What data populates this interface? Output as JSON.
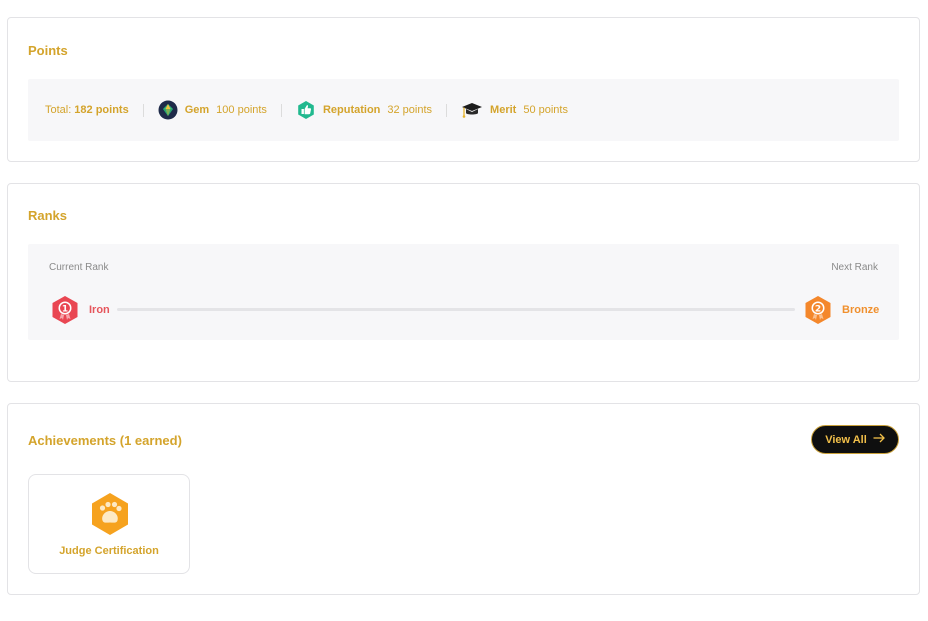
{
  "points": {
    "title": "Points",
    "total_label": "Total:",
    "total_value": "182 points",
    "items": [
      {
        "name": "Gem",
        "value": "100 points",
        "icon": "gem-icon"
      },
      {
        "name": "Reputation",
        "value": "32 points",
        "icon": "thumbs-up-icon"
      },
      {
        "name": "Merit",
        "value": "50 points",
        "icon": "graduation-cap-icon"
      }
    ]
  },
  "ranks": {
    "title": "Ranks",
    "current_label": "Current Rank",
    "next_label": "Next Rank",
    "current": {
      "number": "1",
      "name": "Iron",
      "color": "#e94652"
    },
    "next": {
      "number": "2",
      "name": "Bronze",
      "color": "#f4872b"
    }
  },
  "achievements": {
    "title": "Achievements (1 earned)",
    "view_all_label": "View All",
    "items": [
      {
        "name": "Judge Certification",
        "icon": "paw-icon",
        "color": "#f6a21e"
      }
    ]
  },
  "colors": {
    "accent": "#d4a42c",
    "panel_bg": "#f7f7f9",
    "button_bg": "#0f0f0f"
  }
}
